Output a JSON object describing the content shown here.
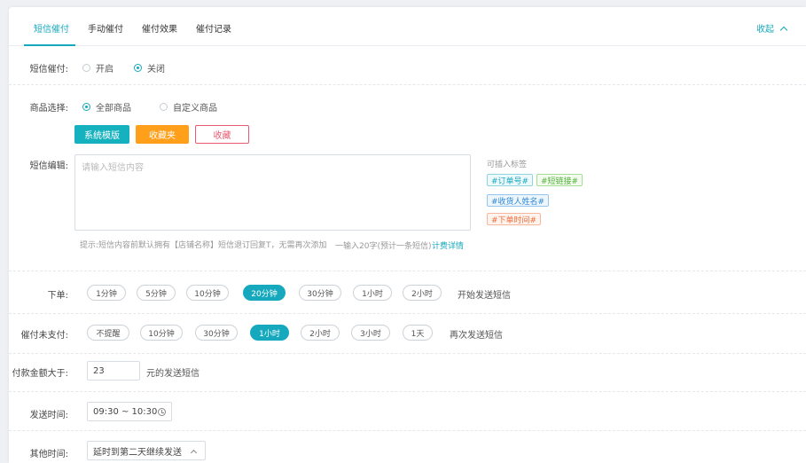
{
  "tabs": [
    {
      "label": "短信催付"
    },
    {
      "label": "手动催付"
    },
    {
      "label": "催付效果"
    },
    {
      "label": "催付记录"
    }
  ],
  "collapse_label": "收起",
  "sms_reminder": {
    "label": "短信催付:",
    "options": [
      "开启",
      "关闭"
    ],
    "selected": "关闭"
  },
  "product_select": {
    "label": "商品选择:",
    "options": [
      "全部商品",
      "自定义商品"
    ],
    "selected": "全部商品"
  },
  "template_buttons": {
    "system": "系统模版",
    "favorites": "收藏夹",
    "collect": "收藏"
  },
  "sms_edit": {
    "label": "短信编辑:",
    "placeholder": "请输入短信内容",
    "hint": "提示:短信内容前默认拥有【店铺名称】短信退订回复T，无需再次添加",
    "count_text": "一输入20字(预计一条短信)",
    "billing_link": "计费详情"
  },
  "insert_tags": {
    "title": "可插入标签",
    "tags": [
      "#订单号#",
      "#短链接#",
      "#收货人姓名#",
      "#下单时间#"
    ]
  },
  "order_placed": {
    "label": "下单:",
    "options": [
      "1分钟",
      "5分钟",
      "10分钟",
      "20分钟",
      "30分钟",
      "1小时",
      "2小时"
    ],
    "selected": "20分钟",
    "suffix": "开始发送短信"
  },
  "unpaid": {
    "label": "催付未支付:",
    "options": [
      "不提醒",
      "10分钟",
      "30分钟",
      "1小时",
      "2小时",
      "3小时",
      "1天"
    ],
    "selected": "1小时",
    "suffix": "再次发送短信"
  },
  "amount": {
    "label": "付款金额大于:",
    "value": "23",
    "suffix": "元的发送短信"
  },
  "send_time": {
    "label": "发送时间:",
    "value": "09:30 ~ 10:30"
  },
  "other_time": {
    "label": "其他时间:",
    "value": "延时到第二天继续发送"
  },
  "colors": {
    "accent": "#16a9bd",
    "orange": "#ff9f1a",
    "red": "#e85a70"
  }
}
